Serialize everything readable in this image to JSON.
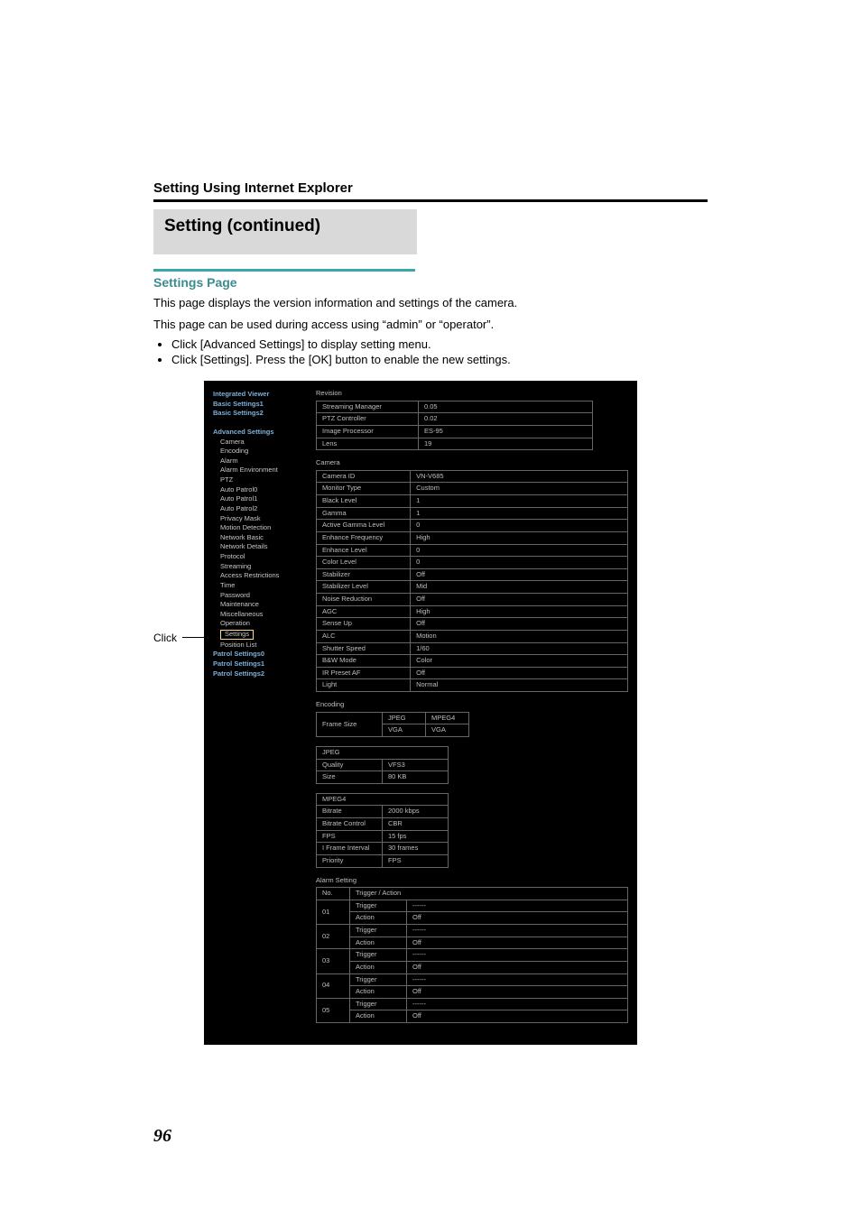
{
  "header": {
    "section": "Setting Using Internet Explorer",
    "blockTitle": "Setting (continued)",
    "subheading": "Settings Page",
    "para1": "This page displays the version information and settings of the camera.",
    "para2": "This page can be used during access using “admin” or “operator”.",
    "bullets": [
      "Click [Advanced Settings] to display setting menu.",
      "Click [Settings]. Press the [OK] button to enable the new settings."
    ],
    "clickLabel": "Click"
  },
  "sidebar": {
    "topLinks": [
      "Integrated Viewer",
      "Basic Settings1",
      "Basic Settings2"
    ],
    "advanced": "Advanced Settings",
    "advItems": [
      "Camera",
      "Encoding",
      "Alarm",
      "Alarm Environment",
      "PTZ",
      "Auto Patrol0",
      "Auto Patrol1",
      "Auto Patrol2",
      "Privacy Mask",
      "Motion Detection",
      "Network Basic",
      "Network Details",
      "Protocol",
      "Streaming",
      "Access Restrictions",
      "Time",
      "Password",
      "Maintenance",
      "Miscellaneous",
      "Operation"
    ],
    "selected": "Settings",
    "afterSelected": "Position List",
    "patrol": [
      "Patrol Settings0",
      "Patrol Settings1",
      "Patrol Settings2"
    ]
  },
  "revision": {
    "title": "Revision",
    "rows": [
      [
        "Streaming Manager",
        "0.05"
      ],
      [
        "PTZ Controller",
        "0.02"
      ],
      [
        "Image Processor",
        "ES-95"
      ],
      [
        "Lens",
        "19"
      ]
    ]
  },
  "camera": {
    "title": "Camera",
    "rows": [
      [
        "Camera ID",
        "VN-V685"
      ],
      [
        "Monitor Type",
        "Custom"
      ],
      [
        "Black Level",
        "1"
      ],
      [
        "Gamma",
        "1"
      ],
      [
        "Active Gamma Level",
        "0"
      ],
      [
        "Enhance Frequency",
        "High"
      ],
      [
        "Enhance Level",
        "0"
      ],
      [
        "Color Level",
        "0"
      ],
      [
        "Stabilizer",
        "Off"
      ],
      [
        "Stabilizer Level",
        "Mid"
      ],
      [
        "Noise Reduction",
        "Off"
      ],
      [
        "AGC",
        "High"
      ],
      [
        "Sense Up",
        "Off"
      ],
      [
        "ALC",
        "Motion"
      ],
      [
        "Shutter Speed",
        "1/60"
      ],
      [
        "B&W Mode",
        "Color"
      ],
      [
        "IR Preset AF",
        "Off"
      ],
      [
        "Light",
        "Normal"
      ]
    ]
  },
  "encoding": {
    "title": "Encoding",
    "frame": {
      "label": "Frame Size",
      "cols": [
        "JPEG",
        "MPEG4"
      ],
      "vals": [
        "VGA",
        "VGA"
      ]
    },
    "jpegTitle": "JPEG",
    "jpeg": [
      [
        "Quality",
        "VFS3"
      ],
      [
        "Size",
        "80 KB"
      ]
    ],
    "mpegTitle": "MPEG4",
    "mpeg": [
      [
        "Bitrate",
        "2000 kbps"
      ],
      [
        "Bitrate Control",
        "CBR"
      ],
      [
        "FPS",
        "15 fps"
      ],
      [
        "I Frame Interval",
        "30 frames"
      ],
      [
        "Priority",
        "FPS"
      ]
    ]
  },
  "alarm": {
    "title": "Alarm Setting",
    "head": [
      "No.",
      "Trigger / Action"
    ],
    "rows": [
      {
        "no": "01",
        "trigger": "------",
        "action": "Off"
      },
      {
        "no": "02",
        "trigger": "------",
        "action": "Off"
      },
      {
        "no": "03",
        "trigger": "------",
        "action": "Off"
      },
      {
        "no": "04",
        "trigger": "------",
        "action": "Off"
      },
      {
        "no": "05",
        "trigger": "------",
        "action": "Off"
      }
    ],
    "triggerLabel": "Trigger",
    "actionLabel": "Action"
  },
  "pageNumber": "96"
}
